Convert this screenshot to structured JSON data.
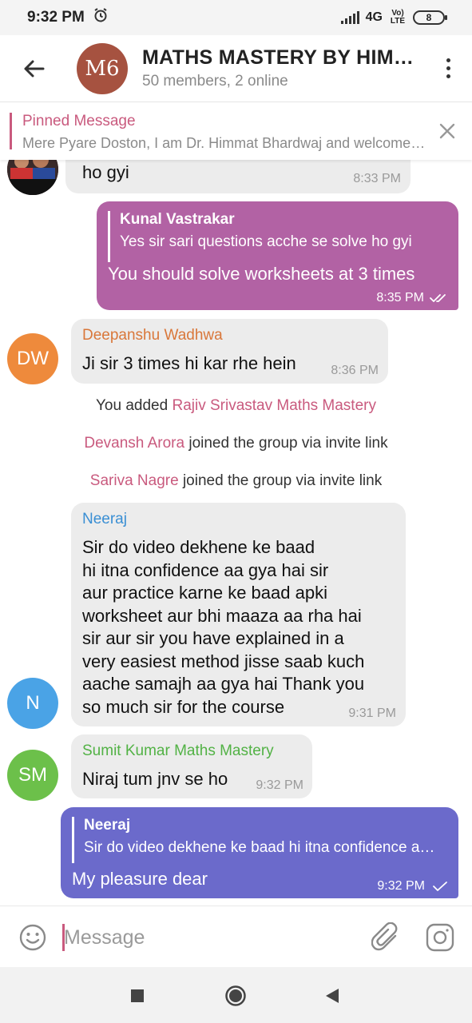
{
  "status_bar": {
    "time": "9:32 PM",
    "network": "4G",
    "volte": "Vo) LTE",
    "battery": "8"
  },
  "header": {
    "avatar_text": "M6",
    "title": "MATHS MASTERY BY HIMMAT BHARDWAJ",
    "subtitle": "50 members, 2 online",
    "avatar_color": "#a65240"
  },
  "pinned": {
    "label": "Pinned Message",
    "text": "Mere Pyare Doston,  I am Dr. Himmat Bhardwaj and welcome to Maths Mastery"
  },
  "messages": [
    {
      "type": "incoming",
      "text": "ho gyi",
      "time": "8:33 PM"
    },
    {
      "type": "outgoing",
      "reply_to": {
        "name": "Kunal Vastrakar",
        "text": "Yes sir sari questions acche se solve ho gyi"
      },
      "text": "You should solve worksheets at 3 times",
      "time": "8:35 PM",
      "status": "read"
    },
    {
      "type": "incoming",
      "sender": "Deepanshu Wadhwa",
      "avatar": "DW",
      "text": "Ji sir 3 times hi kar rhe hein",
      "time": "8:36 PM"
    },
    {
      "type": "service",
      "prefix": "You added ",
      "name": "Rajiv Srivastav Maths Mastery"
    },
    {
      "type": "service",
      "name": "Devansh Arora",
      "suffix": " joined the group via invite link"
    },
    {
      "type": "service",
      "name": "Sariva Nagre",
      "suffix": " joined the group via invite link"
    },
    {
      "type": "incoming",
      "sender": "Neeraj",
      "avatar": "N",
      "lines": [
        "Sir do video dekhene ke baad",
        "hi itna confidence aa gya hai sir",
        "aur practice karne ke baad apki",
        "worksheet aur bhi maaza aa rha hai",
        "sir aur sir you have explained in a",
        "very easiest method jisse saab kuch",
        "aache samajh aa gya hai Thank you",
        "so much sir for the course"
      ],
      "time": "9:31 PM"
    },
    {
      "type": "incoming",
      "sender": "Sumit Kumar Maths Mastery",
      "avatar": "SM",
      "text": "Niraj tum jnv se ho",
      "time": "9:32 PM"
    },
    {
      "type": "outgoing",
      "reply_to": {
        "name": "Neeraj",
        "text": "Sir do video dekhene ke baad hi itna confidence aa gya hai sir"
      },
      "text": "My pleasure dear",
      "time": "9:32 PM",
      "status": "sent"
    }
  ],
  "composer": {
    "placeholder": "Message"
  },
  "colors": {
    "accent_pink": "#c95a7e",
    "outgoing_bubble_1": "#b262a4",
    "outgoing_bubble_2": "#6b6acb",
    "incoming_bubble": "#ececec",
    "deepanshu_name": "#d9773a",
    "neeraj_name": "#3a8fd4",
    "sumit_name": "#52b245",
    "avatar_dw": "#ee8a3c",
    "avatar_n": "#4aa3e6",
    "avatar_sm": "#6cc04a"
  }
}
